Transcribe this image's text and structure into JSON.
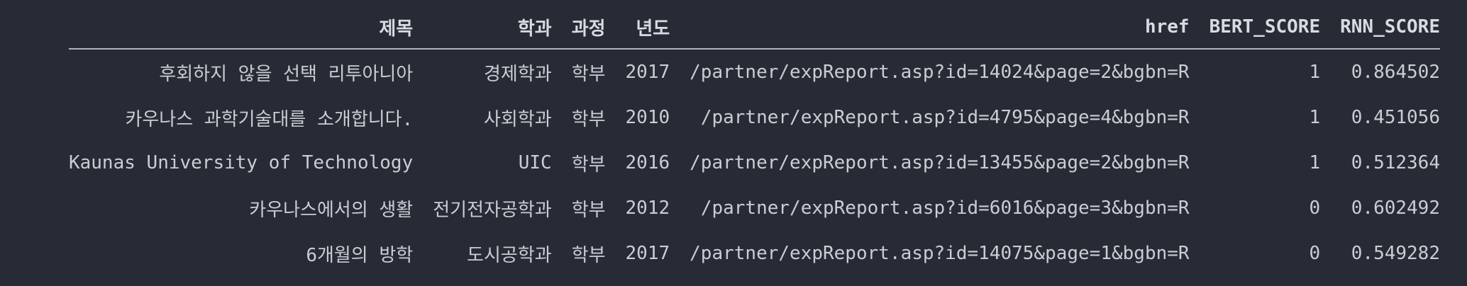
{
  "table": {
    "columns": [
      "제목",
      "학과",
      "과정",
      "년도",
      "href",
      "BERT_SCORE",
      "RNN_SCORE"
    ],
    "rows": [
      [
        "후회하지 않을 선택 리투아니아",
        "경제학과",
        "학부",
        "2017",
        "/partner/expReport.asp?id=14024&page=2&bgbn=R",
        "1",
        "0.864502"
      ],
      [
        "카우나스 과학기술대를 소개합니다.",
        "사회학과",
        "학부",
        "2010",
        "/partner/expReport.asp?id=4795&page=4&bgbn=R",
        "1",
        "0.451056"
      ],
      [
        "Kaunas University of Technology",
        "UIC",
        "학부",
        "2016",
        "/partner/expReport.asp?id=13455&page=2&bgbn=R",
        "1",
        "0.512364"
      ],
      [
        "카우나스에서의 생활",
        "전기전자공학과",
        "학부",
        "2012",
        "/partner/expReport.asp?id=6016&page=3&bgbn=R",
        "0",
        "0.602492"
      ],
      [
        "6개월의 방학",
        "도시공학과",
        "학부",
        "2017",
        "/partner/expReport.asp?id=14075&page=1&bgbn=R",
        "0",
        "0.549282"
      ]
    ]
  }
}
